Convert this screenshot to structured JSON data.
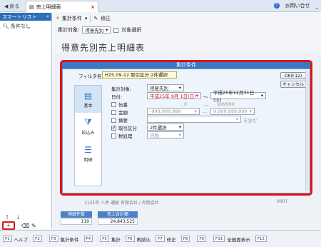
{
  "tabbar": {
    "back_label": "戻る",
    "tab_label": "売上明細表",
    "help_label": "お問い合せ"
  },
  "sidebar": {
    "title": "スマートリスト",
    "item_label": "条件なし"
  },
  "toolbar": {
    "cond_label": "集計条件",
    "edit_label": "修正"
  },
  "condrow": {
    "target_label": "集計対象:",
    "target_value": "得意先別",
    "option_label": "対象選択"
  },
  "page": {
    "title": "得意先別売上明細表"
  },
  "background": {
    "row_fragment": "1131号 八木 通販 有限会社 / 有限会社",
    "code_fragment": "0007"
  },
  "summary": {
    "count_label": "明細件数",
    "count_value": "119",
    "total_label": "売上合計額",
    "total_value": "24,843,525"
  },
  "fbar": {
    "keys": [
      {
        "key": "F1",
        "label": "ヘルプ"
      },
      {
        "key": "F2",
        "label": ""
      },
      {
        "key": "F3",
        "label": "集計条件"
      },
      {
        "key": "F4",
        "label": ""
      },
      {
        "key": "F5",
        "label": "集計"
      },
      {
        "key": "F6",
        "label": "再読込"
      },
      {
        "key": "F7",
        "label": "修正"
      },
      {
        "key": "F8",
        "label": ""
      },
      {
        "key": "F9",
        "label": ""
      },
      {
        "key": "F11",
        "label": "全画面表示"
      },
      {
        "key": "F12",
        "label": ""
      }
    ]
  },
  "dialog": {
    "title": "集計条件",
    "filter_label": "フィルタ名:",
    "filter_value": "H25.09-12 取引区分:2件選択",
    "ok_label": "OK(F12)",
    "cancel_label": "キャンセル",
    "nav": {
      "basic": "基本",
      "narrow": "絞込み",
      "detail": "明細"
    },
    "target_label": "集計対象:",
    "target_value": "得意先別",
    "date_label": "日付:",
    "date_from": "平成25年 9月 1日(日)",
    "date_to": "平成25年12月31日(火)",
    "voucher_label": "伝番",
    "voucher_from": "0",
    "voucher_to": "999999",
    "amount_label": "金額",
    "amount_from": "-999,999,999",
    "amount_to": "9,999,999,999",
    "summary_label": "摘要",
    "summary_suffix": "を含む",
    "txn_label": "取引区分",
    "txn_value": "2件選択",
    "tax_label": "税処理",
    "tax_value": "内税"
  },
  "colors": {
    "accent": "#3a78c2",
    "highlight": "#e0121a",
    "date_red": "#c0151c"
  },
  "icons": [
    "back-arrow-icon",
    "search-icon",
    "pencil-icon",
    "help-icon",
    "filter-icon",
    "calendar-icon",
    "document-icon",
    "list-icon",
    "add-icon",
    "eraser-icon",
    "pointer-icon"
  ]
}
